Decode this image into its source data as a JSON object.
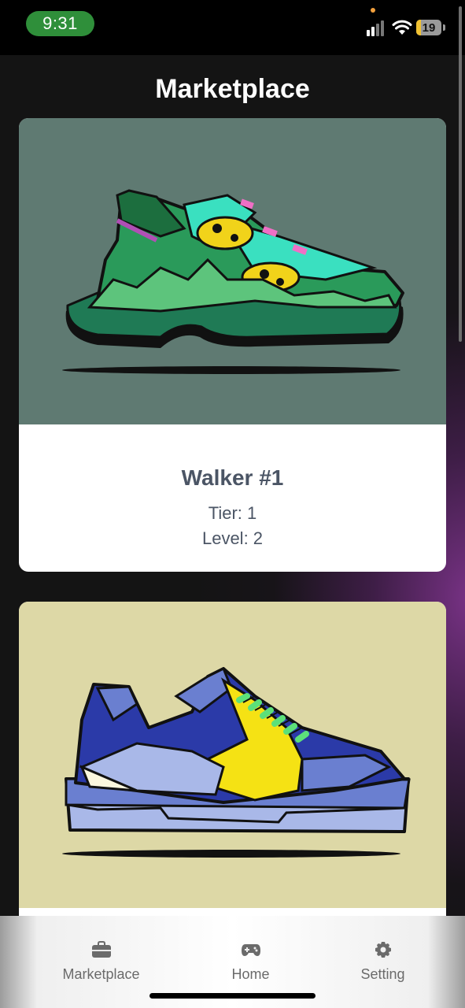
{
  "status_bar": {
    "time": "9:31",
    "battery_level": "19",
    "signal_icon": "cellular-signal-icon",
    "wifi_icon": "wifi-icon",
    "battery_color": "#f1c232",
    "time_pill_color": "#2f8f3a"
  },
  "header": {
    "title": "Marketplace"
  },
  "cards": [
    {
      "name": "Walker #1",
      "tier": "Tier: 1",
      "level": "Level: 2",
      "image": "green-sneaker-illustration",
      "image_bg": "#5f7a72"
    },
    {
      "name": "",
      "tier": "",
      "level": "",
      "image": "blue-yellow-sneaker-illustration",
      "image_bg": "#ddd8a6"
    }
  ],
  "tab_bar": {
    "tabs": [
      {
        "label": "Marketplace",
        "icon": "briefcase-icon"
      },
      {
        "label": "Home",
        "icon": "gamepad-icon"
      },
      {
        "label": "Setting",
        "icon": "gear-icon"
      }
    ]
  }
}
